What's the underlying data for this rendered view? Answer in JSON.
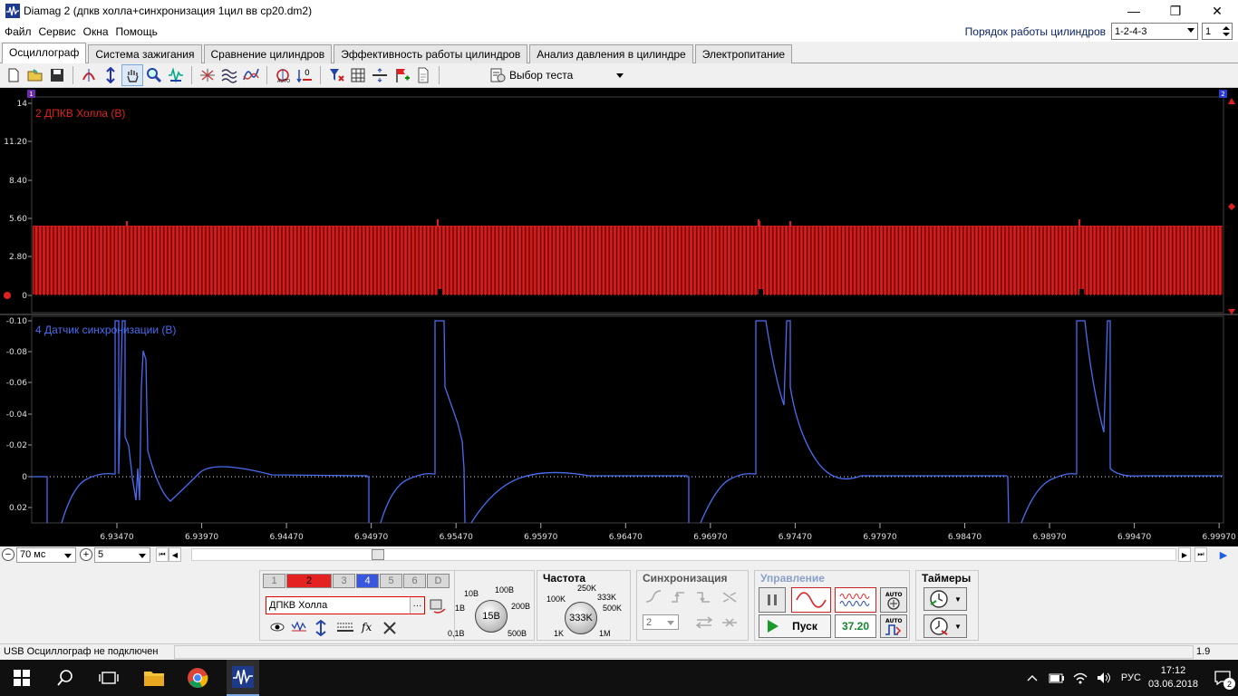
{
  "window": {
    "title": "Diamag 2 (дпкв холла+синхронизация 1цил вв ср20.dm2)",
    "minimize": "—",
    "maximize": "❐",
    "close": "✕"
  },
  "menu": [
    "Файл",
    "Сервис",
    "Окна",
    "Помощь"
  ],
  "cylinder_order": {
    "label": "Порядок работы цилиндров",
    "value": "1-2-4-3",
    "cylinder": "1"
  },
  "tabs": [
    {
      "label": "Осциллограф",
      "active": true
    },
    {
      "label": "Система зажигания",
      "active": false
    },
    {
      "label": "Сравнение цилиндров",
      "active": false
    },
    {
      "label": "Эффективность работы цилиндров",
      "active": false
    },
    {
      "label": "Анализ давления в цилиндре",
      "active": false
    },
    {
      "label": "Электропитание",
      "active": false
    }
  ],
  "toolbar": {
    "icons": [
      "new-file-icon",
      "open-folder-icon",
      "save-icon",
      "cursor-marker-icon",
      "vertical-scale-icon",
      "hand-pan-icon",
      "zoom-icon",
      "signal-filter-icon",
      "spectrum-icon",
      "waves-icon",
      "smooth-icon",
      "auto-scale-icon",
      "zero-offset-icon",
      "filter-funnel-icon",
      "grid-icon",
      "horizontal-line-icon",
      "flag-add-icon",
      "document-icon"
    ],
    "test_select": "Выбор теста"
  },
  "scope": {
    "channel_top": {
      "label": "2 ДПКВ Холла (В)",
      "color": "#e02020",
      "y_ticks": [
        "14",
        "11.20",
        "8.40",
        "5.60",
        "2.80",
        "0"
      ]
    },
    "channel_bottom": {
      "label": "4 Датчик синхронизации (В)",
      "color": "#4a6cf0",
      "y_ticks": [
        "-0.10",
        "-0.08",
        "-0.06",
        "-0.04",
        "-0.02",
        "0",
        "0.02"
      ]
    },
    "x_ticks": [
      "6.93470",
      "6.93970",
      "6.94470",
      "6.94970",
      "6.95470",
      "6.95970",
      "6.96470",
      "6.96970",
      "6.97470",
      "6.97970",
      "6.98470",
      "6.98970",
      "6.99470",
      "6.99970"
    ],
    "marker_left": "1",
    "marker_right": "2"
  },
  "timerow": {
    "timebase": "70 мс",
    "zoom": "5"
  },
  "panel": {
    "channels": [
      "1",
      "2",
      "3",
      "4",
      "5",
      "6",
      "D"
    ],
    "active_channel": "2",
    "channel_name": "ДПКВ Холла",
    "volt_knob": {
      "value": "15В",
      "labels": [
        "10В",
        "100В",
        "1В",
        "200В",
        "0,1В",
        "500В"
      ]
    },
    "frequency": {
      "title": "Частота",
      "value": "333K",
      "labels": [
        "250K",
        "100K",
        "333K",
        "500K",
        "1K",
        "1M"
      ]
    },
    "sync": {
      "title": "Синхронизация",
      "channel": "2"
    },
    "control": {
      "title": "Управление",
      "start": "Пуск",
      "value": "37.20",
      "auto": "AUTO"
    },
    "timers": {
      "title": "Таймеры"
    }
  },
  "status": {
    "left": "USB Осциллограф не подключен",
    "right": "1.9"
  },
  "taskbar": {
    "lang": "РУС",
    "time": "17:12",
    "date": "03.06.2018",
    "notifications": "2"
  }
}
